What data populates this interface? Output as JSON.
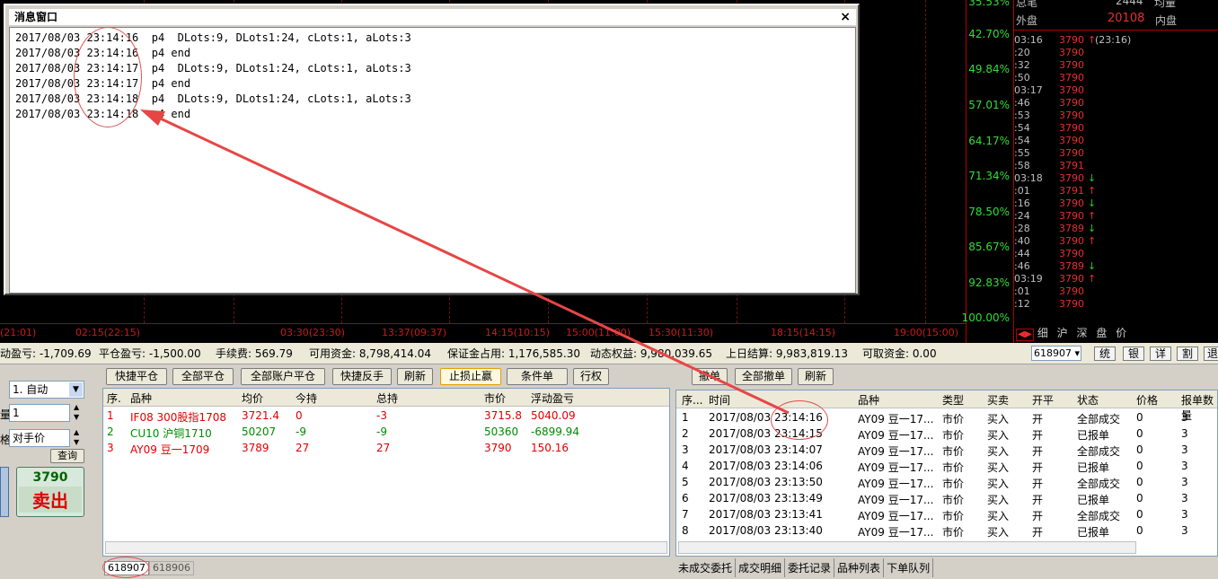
{
  "chart": {
    "pct_labels": [
      "42.70%",
      "49.84%",
      "57.01%",
      "64.17%",
      "71.34%",
      "78.50%",
      "85.67%",
      "92.83%",
      "100.00%"
    ],
    "top_pct_partial": "35.53%",
    "time_labels": [
      "(21:01)",
      "02:15(22:15)",
      "03:30(23:30)",
      "13:37(09:37)",
      "14:15(10:15)",
      "15:00(11:00)",
      "15:30(11:30)",
      "18:15(14:15)",
      "19:00(15:00)"
    ]
  },
  "quote_header": {
    "zongbi_label": "总笔",
    "zongbi_value": "2444",
    "junliang_label": "均量",
    "waipan_label": "外盘",
    "waipan_value": "20108",
    "neipan_label": "内盘"
  },
  "ticks": [
    {
      "time": "03:16",
      "price": "3790",
      "arrow": "↑",
      "arrow_color": "#e63030",
      "extra": "(23:16)"
    },
    {
      "time": ":20",
      "price": "3790",
      "arrow": "",
      "arrow_color": "",
      "extra": ""
    },
    {
      "time": ":32",
      "price": "3790",
      "arrow": "",
      "arrow_color": "",
      "extra": ""
    },
    {
      "time": ":50",
      "price": "3790",
      "arrow": "",
      "arrow_color": "",
      "extra": ""
    },
    {
      "time": "03:17",
      "price": "3790",
      "arrow": "",
      "arrow_color": "",
      "extra": ""
    },
    {
      "time": ":46",
      "price": "3790",
      "arrow": "",
      "arrow_color": "",
      "extra": ""
    },
    {
      "time": ":53",
      "price": "3790",
      "arrow": "",
      "arrow_color": "",
      "extra": ""
    },
    {
      "time": ":54",
      "price": "3790",
      "arrow": "",
      "arrow_color": "",
      "extra": ""
    },
    {
      "time": ":54",
      "price": "3790",
      "arrow": "",
      "arrow_color": "",
      "extra": ""
    },
    {
      "time": ":55",
      "price": "3790",
      "arrow": "",
      "arrow_color": "",
      "extra": ""
    },
    {
      "time": ":58",
      "price": "3791",
      "arrow": "",
      "arrow_color": "",
      "extra": ""
    },
    {
      "time": "03:18",
      "price": "3790",
      "arrow": "↓",
      "arrow_color": "#22cc22",
      "extra": ""
    },
    {
      "time": ":01",
      "price": "3791",
      "arrow": "↑",
      "arrow_color": "#e63030",
      "extra": ""
    },
    {
      "time": ":16",
      "price": "3790",
      "arrow": "↓",
      "arrow_color": "#22cc22",
      "extra": ""
    },
    {
      "time": ":24",
      "price": "3790",
      "arrow": "↑",
      "arrow_color": "#e63030",
      "extra": ""
    },
    {
      "time": ":28",
      "price": "3789",
      "arrow": "↓",
      "arrow_color": "#22cc22",
      "extra": ""
    },
    {
      "time": ":40",
      "price": "3790",
      "arrow": "↑",
      "arrow_color": "#e63030",
      "extra": ""
    },
    {
      "time": ":44",
      "price": "3790",
      "arrow": "",
      "arrow_color": "",
      "extra": ""
    },
    {
      "time": ":46",
      "price": "3789",
      "arrow": "↓",
      "arrow_color": "#22cc22",
      "extra": ""
    },
    {
      "time": "03:19",
      "price": "3790",
      "arrow": "↑",
      "arrow_color": "#e63030",
      "extra": ""
    },
    {
      "time": ":01",
      "price": "3790",
      "arrow": "",
      "arrow_color": "",
      "extra": ""
    },
    {
      "time": ":12",
      "price": "3790",
      "arrow": "",
      "arrow_color": "",
      "extra": ""
    }
  ],
  "quote_tabs": [
    "细",
    "沪",
    "深",
    "盘",
    "价"
  ],
  "message_window": {
    "title": "消息窗口",
    "close": "×",
    "lines": [
      "2017/08/03 23:14:16  p4  DLots:9, DLots1:24, cLots:1, aLots:3",
      "2017/08/03 23:14:16  p4 end",
      "2017/08/03 23:14:17  p4  DLots:9, DLots1:24, cLots:1, aLots:3",
      "2017/08/03 23:14:17  p4 end",
      "2017/08/03 23:14:18  p4  DLots:9, DLots1:24, cLots:1, aLots:3",
      "2017/08/03 23:14:18  p4 end"
    ]
  },
  "status": {
    "floating": "动盈亏: -1,709.69",
    "closing": "平仓盈亏: -1,500.00",
    "fee": "手续费: 569.79",
    "available": "可用资金: 8,798,414.04",
    "margin": "保证金占用: 1,176,585.30",
    "equity": "动态权益: 9,980,039.65",
    "settle": "上日结算: 9,983,819.13",
    "withdraw": "可取资金: 0.00",
    "account": "618907",
    "buttons": [
      "统",
      "银",
      "详",
      "割",
      "退"
    ]
  },
  "order_panel": {
    "kaiping_value": "1. 自动",
    "qty_label": "量",
    "qty_value": "1",
    "price_label": "格",
    "price_value": "对手价",
    "query_btn": "查询",
    "sell_price": "3790",
    "sell_label": "卖出"
  },
  "position_toolbar": [
    "快捷平仓",
    "全部平仓",
    "全部账户平仓",
    "快捷反手",
    "刷新",
    "止损止赢",
    "条件单",
    "行权"
  ],
  "positions": {
    "headers": [
      "序.",
      "品种",
      "均价",
      "今持",
      "总持",
      "市价",
      "浮动盈亏"
    ],
    "rows": [
      {
        "c": [
          "1",
          "IF08 300股指1708",
          "3721.4",
          "0",
          "-3",
          "3715.8",
          "5040.09"
        ],
        "color": "#e00000"
      },
      {
        "c": [
          "2",
          "CU10 沪铜1710",
          "50207",
          "-9",
          "-9",
          "50360",
          "-6899.94"
        ],
        "color": "#008a00"
      },
      {
        "c": [
          "3",
          "AY09 豆一1709",
          "3789",
          "27",
          "27",
          "3790",
          "150.16"
        ],
        "color": "#e00000"
      }
    ]
  },
  "account_tabs": [
    "618907",
    "618906"
  ],
  "order_toolbar": [
    "撤单",
    "全部撤单",
    "刷新"
  ],
  "orders": {
    "headers": [
      "序...",
      "时间",
      "品种",
      "类型",
      "买卖",
      "开平",
      "状态",
      "价格",
      "报单数量"
    ],
    "rows": [
      [
        "1",
        "2017/08/03 23:14:16",
        "AY09 豆一17...",
        "市价",
        "买入",
        "开",
        "全部成交",
        "0",
        "3"
      ],
      [
        "2",
        "2017/08/03 23:14:15",
        "AY09 豆一17...",
        "市价",
        "买入",
        "开",
        "已报单",
        "0",
        "3"
      ],
      [
        "3",
        "2017/08/03 23:14:07",
        "AY09 豆一17...",
        "市价",
        "买入",
        "开",
        "全部成交",
        "0",
        "3"
      ],
      [
        "4",
        "2017/08/03 23:14:06",
        "AY09 豆一17...",
        "市价",
        "买入",
        "开",
        "已报单",
        "0",
        "3"
      ],
      [
        "5",
        "2017/08/03 23:13:50",
        "AY09 豆一17...",
        "市价",
        "买入",
        "开",
        "全部成交",
        "0",
        "3"
      ],
      [
        "6",
        "2017/08/03 23:13:49",
        "AY09 豆一17...",
        "市价",
        "买入",
        "开",
        "已报单",
        "0",
        "3"
      ],
      [
        "7",
        "2017/08/03 23:13:41",
        "AY09 豆一17...",
        "市价",
        "买入",
        "开",
        "全部成交",
        "0",
        "3"
      ],
      [
        "8",
        "2017/08/03 23:13:40",
        "AY09 豆一17...",
        "市价",
        "买入",
        "开",
        "已报单",
        "0",
        "3"
      ]
    ]
  },
  "bottom_tabs": [
    "未成交委托",
    "成交明细",
    "委托记录",
    "品种列表",
    "下单队列"
  ]
}
